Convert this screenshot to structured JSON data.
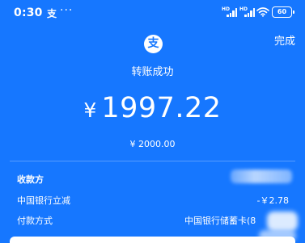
{
  "status_bar": {
    "time": "0:30",
    "app_icon": "支",
    "more": "···",
    "network_1": "HD",
    "network_2": "HD",
    "battery": "60"
  },
  "header": {
    "done_label": "完成"
  },
  "logo": {
    "glyph": "支",
    "icon": "alipay-icon"
  },
  "result": {
    "title": "转账成功",
    "currency": "¥",
    "amount": "1997.22",
    "original_amount": "¥ 2000.00"
  },
  "details": {
    "payee_label": "收款方",
    "discount_label": "中国银行立减",
    "discount_value": "-￥2.78",
    "method_label": "付款方式",
    "method_value": "中国银行储蓄卡(8"
  },
  "colors": {
    "background": "#1677ff",
    "text": "#ffffff"
  }
}
